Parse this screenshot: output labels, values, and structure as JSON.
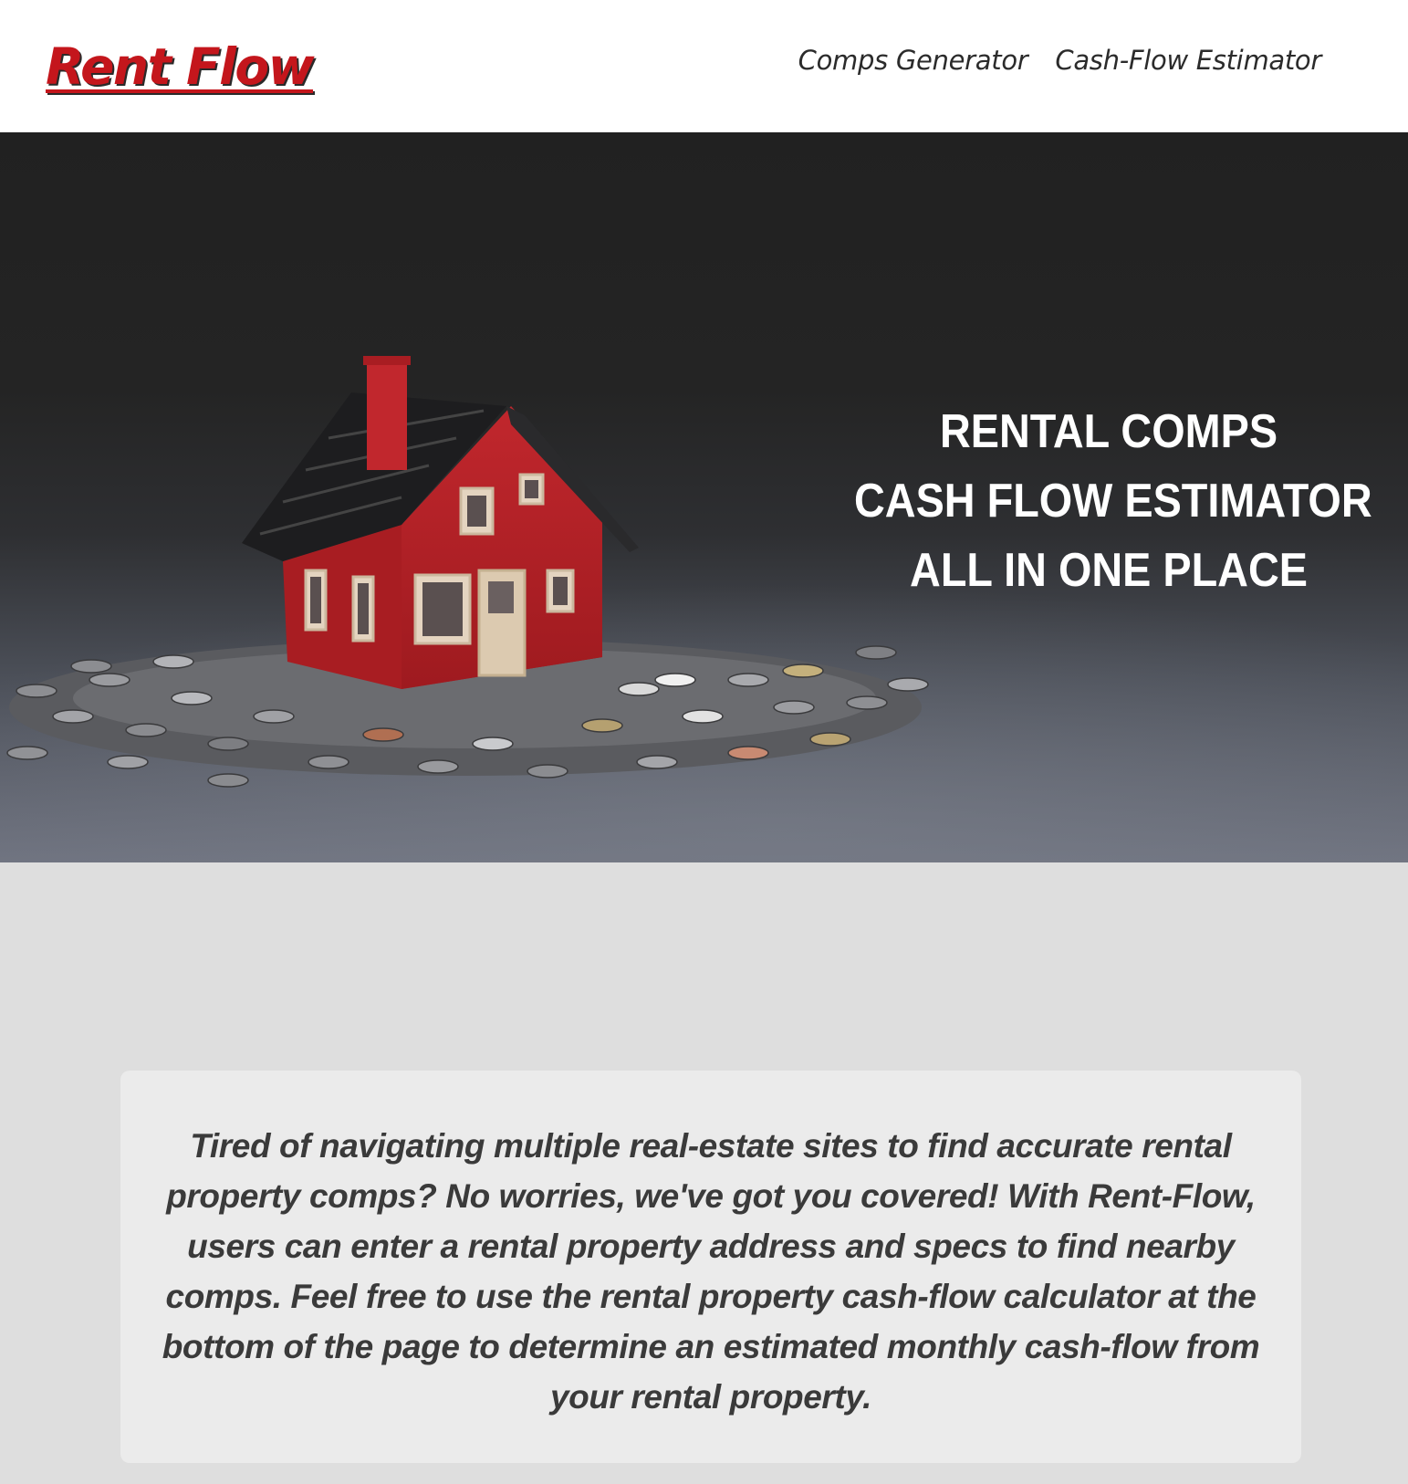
{
  "header": {
    "brand": "Rent Flow",
    "nav": [
      {
        "label": "Comps Generator"
      },
      {
        "label": "Cash-Flow Estimator"
      }
    ]
  },
  "hero": {
    "lines": [
      "RENTAL COMPS",
      "CASH FLOW ESTIMATOR",
      "ALL IN ONE PLACE"
    ],
    "image_subject": "red toy house on a pile of coins"
  },
  "intro": {
    "text": "Tired of navigating multiple real-estate sites to find accurate rental property comps? No worries, we've got you covered! With Rent-Flow, users can enter a rental property address and specs to find nearby comps. Feel free to use the rental property cash-flow calculator at the bottom of the page to determine an estimated monthly cash-flow from your rental property."
  },
  "colors": {
    "brand": "#c4161c",
    "nav_text": "#2b2b2b",
    "page_bg": "#dedede",
    "card_bg": "#ebebeb",
    "hero_text": "#ffffff"
  }
}
